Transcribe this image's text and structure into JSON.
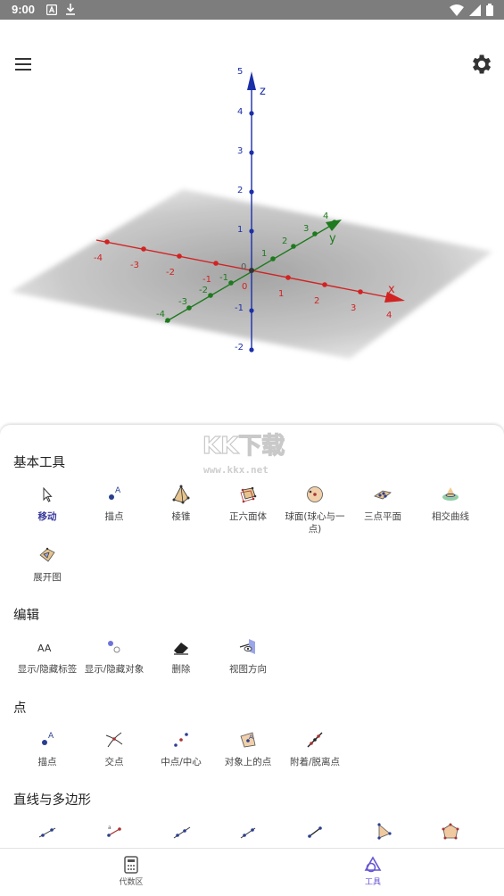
{
  "status_bar": {
    "time": "9:00"
  },
  "view3d": {
    "z_axis_label": "z",
    "x_axis_label": "x",
    "y_axis_label": "y",
    "z_ticks": [
      "5",
      "4",
      "3",
      "2",
      "1",
      "0",
      "-1",
      "-2"
    ],
    "x_ticks": [
      "-4",
      "-3",
      "-2",
      "-1",
      "0",
      "1",
      "2",
      "3",
      "4"
    ],
    "y_ticks": [
      "-4",
      "-3",
      "-2",
      "-1",
      "1",
      "2",
      "3",
      "4"
    ],
    "colors": {
      "x_axis": "#d22222",
      "y_axis": "#1e7a1e",
      "z_axis": "#1b2fa8"
    }
  },
  "watermark": {
    "main": "KK下载",
    "sub": "www.kkx.net"
  },
  "sections": {
    "basic": {
      "title": "基本工具",
      "tools": [
        {
          "label": "移动",
          "icon": "move-arrow-icon"
        },
        {
          "label": "描点",
          "icon": "point-icon"
        },
        {
          "label": "棱锥",
          "icon": "pyramid-icon"
        },
        {
          "label": "正六面体",
          "icon": "cube-icon"
        },
        {
          "label": "球面(球心与一点)",
          "icon": "sphere-icon"
        },
        {
          "label": "三点平面",
          "icon": "plane-three-points-icon"
        },
        {
          "label": "相交曲线",
          "icon": "intersection-curve-icon"
        },
        {
          "label": "展开图",
          "icon": "net-icon"
        }
      ]
    },
    "edit": {
      "title": "编辑",
      "tools": [
        {
          "label": "显示/隐藏标签",
          "icon": "show-hide-label-icon",
          "glyph": "AA"
        },
        {
          "label": "显示/隐藏对象",
          "icon": "show-hide-object-icon"
        },
        {
          "label": "删除",
          "icon": "eraser-icon"
        },
        {
          "label": "视图方向",
          "icon": "view-direction-icon"
        }
      ]
    },
    "point": {
      "title": "点",
      "tools": [
        {
          "label": "描点",
          "icon": "point-icon"
        },
        {
          "label": "交点",
          "icon": "intersect-icon"
        },
        {
          "label": "中点/中心",
          "icon": "midpoint-icon"
        },
        {
          "label": "对象上的点",
          "icon": "point-on-object-icon"
        },
        {
          "label": "附着/脱离点",
          "icon": "attach-detach-icon"
        }
      ]
    },
    "lines": {
      "title": "直线与多边形",
      "tools": [
        {
          "icon": "line-icon"
        },
        {
          "icon": "segment-length-icon"
        },
        {
          "icon": "ray-icon"
        },
        {
          "icon": "vector-icon"
        },
        {
          "icon": "segment-icon"
        },
        {
          "icon": "polygon-icon"
        },
        {
          "icon": "regular-polygon-icon"
        }
      ]
    }
  },
  "bottom_nav": {
    "algebra_label": "代数区",
    "tools_label": "工具"
  }
}
